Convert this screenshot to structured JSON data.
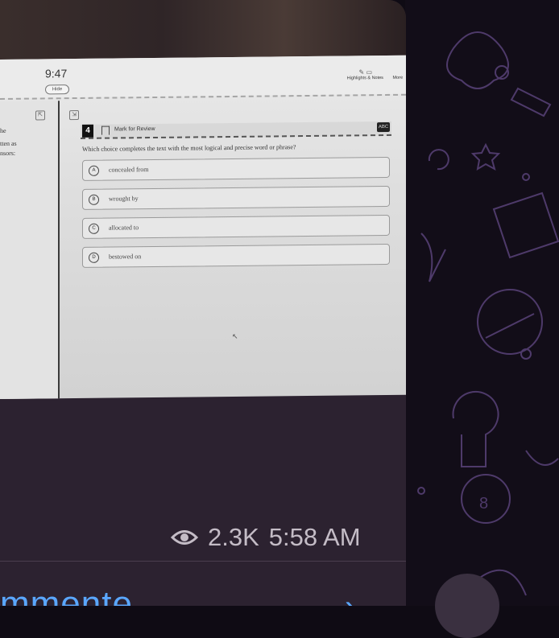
{
  "screen": {
    "time": "9:47",
    "hide_label": "Hide",
    "highlights_label": "Highlights & Notes",
    "more_label": "More",
    "question_number": "4",
    "mark_for_review": "Mark for Review",
    "left_text_fragments": [
      "he",
      "tten as",
      "nsors:"
    ],
    "question": "Which choice completes the text with the most logical and precise word or phrase?",
    "choices": [
      {
        "letter": "A",
        "text": "concealed from"
      },
      {
        "letter": "B",
        "text": "wrought by"
      },
      {
        "letter": "C",
        "text": "allocated to"
      },
      {
        "letter": "D",
        "text": "bestowed on"
      }
    ]
  },
  "message": {
    "views": "2.3K",
    "timestamp": "5:58 AM",
    "comments_label": "mmente"
  },
  "colors": {
    "bubble": "#2c2230",
    "link": "#5aa7ff",
    "meta_text": "#c4bcc6"
  },
  "icons": [
    "eye-icon",
    "chevron-right-icon",
    "bookmark-icon",
    "annotate-icon",
    "expand-icon"
  ]
}
